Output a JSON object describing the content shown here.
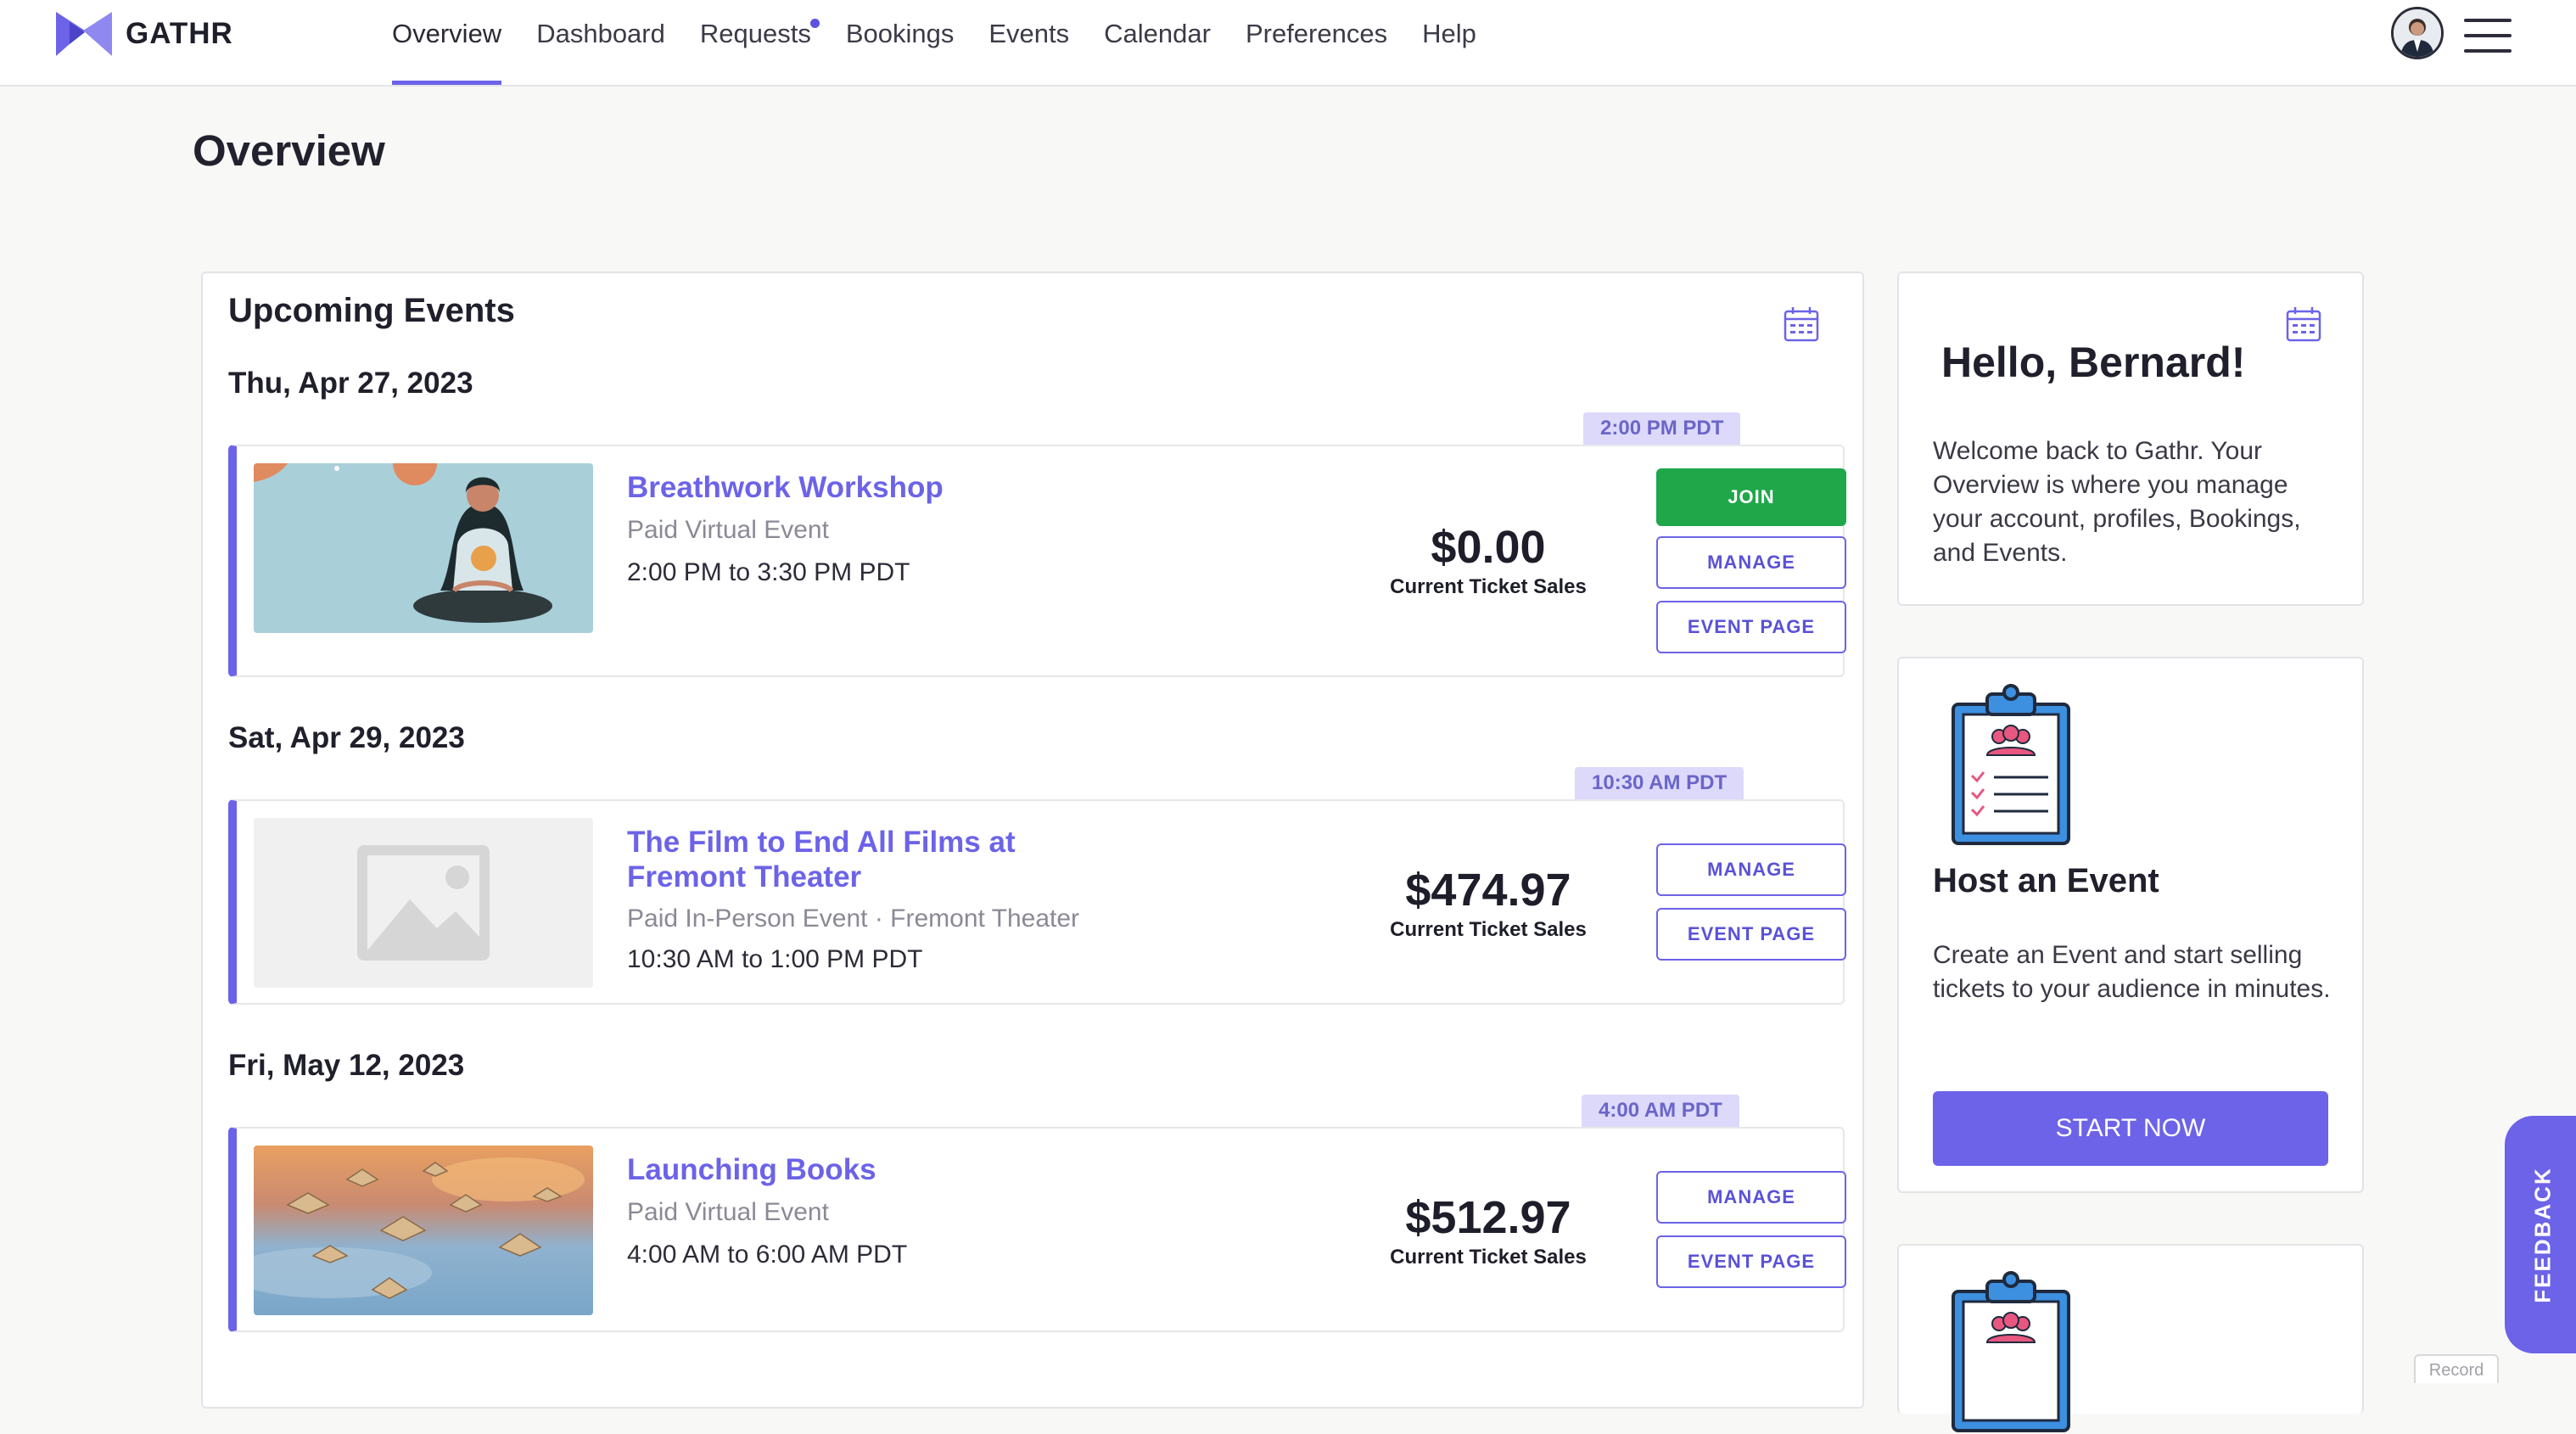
{
  "brand": {
    "name": "GATHR",
    "color": "#6c63e8"
  },
  "nav": {
    "items": [
      {
        "label": "Overview",
        "active": true
      },
      {
        "label": "Dashboard"
      },
      {
        "label": "Requests",
        "has_notification": true
      },
      {
        "label": "Bookings"
      },
      {
        "label": "Events"
      },
      {
        "label": "Calendar"
      },
      {
        "label": "Preferences"
      },
      {
        "label": "Help"
      }
    ],
    "icons": {
      "avatar": "user-avatar",
      "menu": "hamburger-menu-icon"
    }
  },
  "page": {
    "title": "Overview"
  },
  "upcoming": {
    "title": "Upcoming Events",
    "ticket_label": "Current Ticket Sales",
    "groups": [
      {
        "date": "Thu, Apr 27, 2023",
        "time_badge": "2:00 PM PDT",
        "event": {
          "title": "Breathwork Workshop",
          "subtitle": "Paid Virtual Event",
          "time": "2:00 PM to 3:30 PM PDT",
          "ticket_sales": "$0.00",
          "buttons": {
            "join": "JOIN",
            "manage": "MANAGE",
            "event_page": "EVENT PAGE"
          }
        }
      },
      {
        "date": "Sat, Apr 29, 2023",
        "time_badge": "10:30 AM PDT",
        "event": {
          "title": "The Film to End All Films at Fremont Theater",
          "subtitle": "Paid In-Person Event · Fremont Theater",
          "time": "10:30 AM to 1:00 PM PDT",
          "ticket_sales": "$474.97",
          "buttons": {
            "manage": "MANAGE",
            "event_page": "EVENT PAGE"
          }
        }
      },
      {
        "date": "Fri, May 12, 2023",
        "time_badge": "4:00 AM PDT",
        "event": {
          "title": "Launching Books",
          "subtitle": "Paid Virtual Event",
          "time": "4:00 AM to 6:00 AM PDT",
          "ticket_sales": "$512.97",
          "buttons": {
            "manage": "MANAGE",
            "event_page": "EVENT PAGE"
          }
        }
      }
    ]
  },
  "welcome": {
    "greeting": "Hello, Bernard!",
    "text": "Welcome back to Gathr. Your Overview is where you manage your account, profiles, Bookings, and Events."
  },
  "host": {
    "title": "Host an Event",
    "text": "Create an Event and start selling tickets to your audience in minutes.",
    "button": "START NOW"
  },
  "feedback": {
    "label": "FEEDBACK"
  },
  "record": {
    "label": "Record"
  }
}
